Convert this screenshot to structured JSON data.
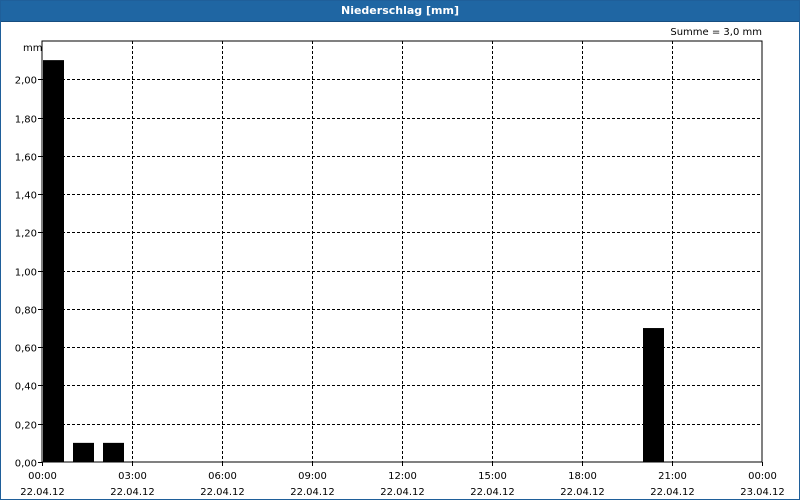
{
  "window": {
    "title": "Niederschlag [mm]"
  },
  "summary": "Summe = 3,0 mm",
  "colors": {
    "titlebar": "#1f66a3",
    "bar": "#000000",
    "grid": "#000000"
  },
  "chart_data": {
    "type": "bar",
    "title": "Niederschlag [mm]",
    "ylabel": "mm",
    "xlabel": "",
    "ylim": [
      0,
      2.2
    ],
    "xlim_hours": [
      0,
      24
    ],
    "y_ticks": [
      "0,00",
      "0,20",
      "0,40",
      "0,60",
      "0,80",
      "1,00",
      "1,20",
      "1,40",
      "1,60",
      "1,80",
      "2,00"
    ],
    "x_ticks": [
      {
        "time": "00:00",
        "date": "22.04.12"
      },
      {
        "time": "03:00",
        "date": "22.04.12"
      },
      {
        "time": "06:00",
        "date": "22.04.12"
      },
      {
        "time": "09:00",
        "date": "22.04.12"
      },
      {
        "time": "12:00",
        "date": "22.04.12"
      },
      {
        "time": "15:00",
        "date": "22.04.12"
      },
      {
        "time": "18:00",
        "date": "22.04.12"
      },
      {
        "time": "21:00",
        "date": "22.04.12"
      },
      {
        "time": "00:00",
        "date": "23.04.12"
      }
    ],
    "bars": [
      {
        "hour": 0,
        "value": 2.1
      },
      {
        "hour": 1,
        "value": 0.1
      },
      {
        "hour": 2,
        "value": 0.1
      },
      {
        "hour": 20,
        "value": 0.7
      }
    ],
    "grid": true
  }
}
